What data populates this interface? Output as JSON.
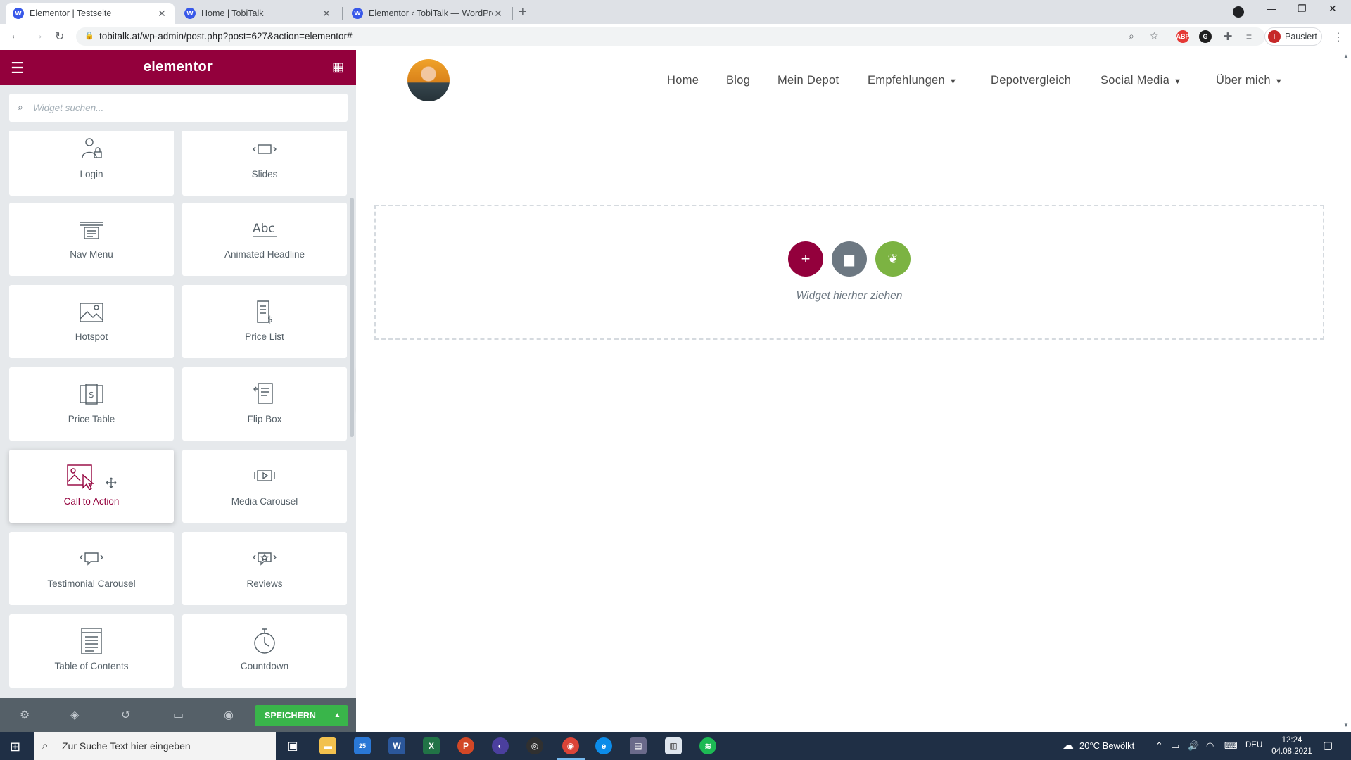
{
  "browser": {
    "tabs": [
      {
        "title": "Elementor | Testseite",
        "active": true
      },
      {
        "title": "Home | TobiTalk",
        "active": false
      },
      {
        "title": "Elementor ‹ TobiTalk — WordPre",
        "active": false
      }
    ],
    "url": "tobitalk.at/wp-admin/post.php?post=627&action=elementor#",
    "profile_label": "Pausiert",
    "profile_initial": "T",
    "ext_abp": "ABP"
  },
  "panel": {
    "brand": "elementor",
    "search_placeholder": "Widget suchen...",
    "widgets": [
      {
        "label": "Login",
        "icon": "login-icon"
      },
      {
        "label": "Slides",
        "icon": "slides-icon"
      },
      {
        "label": "Nav Menu",
        "icon": "nav-menu-icon"
      },
      {
        "label": "Animated Headline",
        "icon": "animated-headline-icon"
      },
      {
        "label": "Hotspot",
        "icon": "hotspot-icon"
      },
      {
        "label": "Price List",
        "icon": "price-list-icon"
      },
      {
        "label": "Price Table",
        "icon": "price-table-icon"
      },
      {
        "label": "Flip Box",
        "icon": "flip-box-icon"
      },
      {
        "label": "Call to Action",
        "icon": "call-to-action-icon"
      },
      {
        "label": "Media Carousel",
        "icon": "media-carousel-icon"
      },
      {
        "label": "Testimonial Carousel",
        "icon": "testimonial-carousel-icon"
      },
      {
        "label": "Reviews",
        "icon": "reviews-icon"
      },
      {
        "label": "Table of Contents",
        "icon": "table-of-contents-icon"
      },
      {
        "label": "Countdown",
        "icon": "countdown-icon"
      }
    ],
    "save_label": "SPEICHERN",
    "colors": {
      "header": "#93003c",
      "save": "#39b54a",
      "footer": "#556068"
    }
  },
  "preview": {
    "nav": [
      {
        "label": "Home",
        "dropdown": false
      },
      {
        "label": "Blog",
        "dropdown": false
      },
      {
        "label": "Mein Depot",
        "dropdown": false
      },
      {
        "label": "Empfehlungen",
        "dropdown": true
      },
      {
        "label": "Depotvergleich",
        "dropdown": false
      },
      {
        "label": "Social Media",
        "dropdown": true
      },
      {
        "label": "Über mich",
        "dropdown": true
      }
    ],
    "drop_text": "Widget hierher ziehen",
    "colors": {
      "add": "#93003c",
      "template": "#6d7882",
      "envato": "#7cb342"
    }
  },
  "taskbar": {
    "search_placeholder": "Zur Suche Text hier eingeben",
    "mail_badge": "25",
    "weather": "20°C  Bewölkt",
    "language": "DEU",
    "time": "12:24",
    "date": "04.08.2021"
  }
}
